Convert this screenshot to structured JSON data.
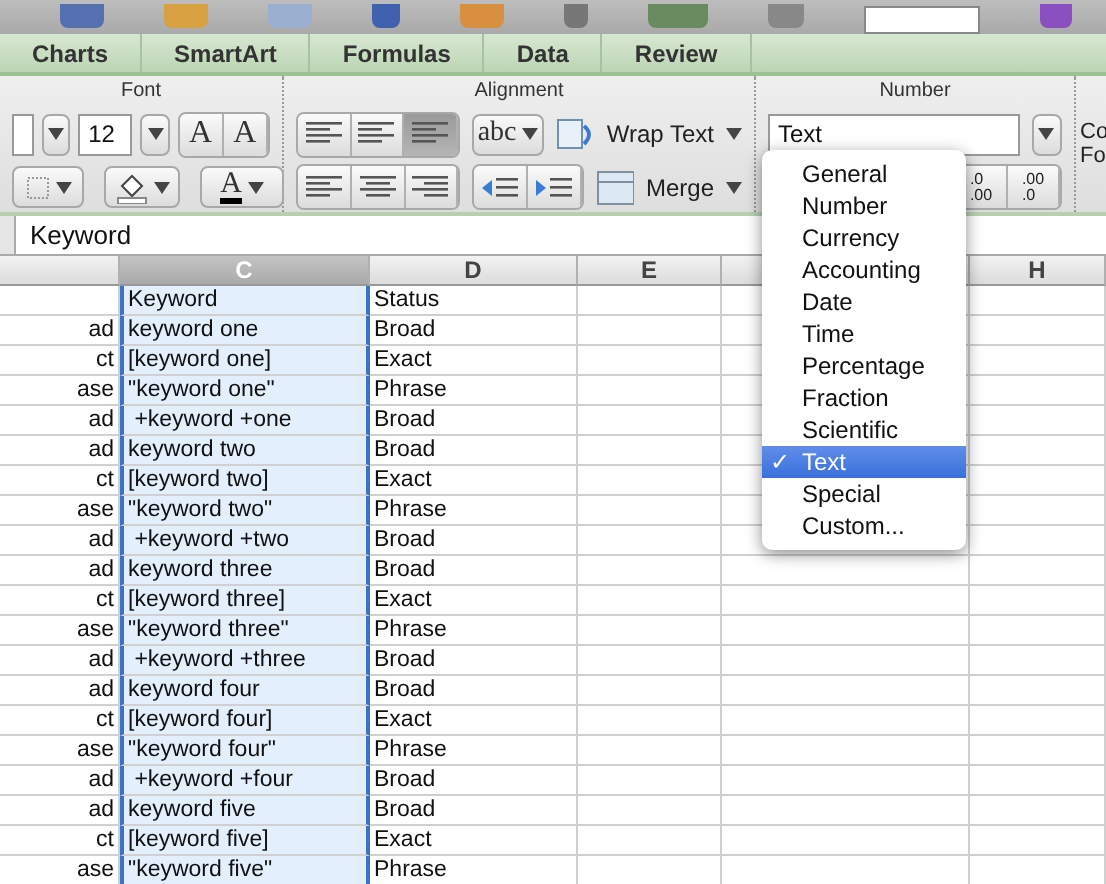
{
  "ribbon_tabs": [
    {
      "label": "Charts"
    },
    {
      "label": "SmartArt"
    },
    {
      "label": "Formulas"
    },
    {
      "label": "Data"
    },
    {
      "label": "Review"
    }
  ],
  "font_group": {
    "label": "Font",
    "size": "12",
    "grow_glyph": "A",
    "shrink_glyph": "A",
    "color_glyph": "A"
  },
  "alignment_group": {
    "label": "Alignment",
    "orientation_glyph": "abc",
    "wrap_text": "Wrap Text",
    "merge": "Merge"
  },
  "number_group": {
    "label": "Number",
    "format": "Text",
    "decimal_increase": [
      ".0",
      ".00"
    ],
    "decimal_decrease": [
      ".00",
      ".0"
    ]
  },
  "next_group_cut": [
    "Co",
    "Fo"
  ],
  "formula_bar": {
    "value": "Keyword"
  },
  "columns": [
    {
      "label": "C",
      "selected": true
    },
    {
      "label": "D",
      "selected": false
    },
    {
      "label": "E",
      "selected": false
    },
    {
      "label": "H",
      "selected": false
    }
  ],
  "rows": [
    {
      "keyword": "Keyword",
      "status": "Status"
    },
    {
      "column_b": "ad",
      "keyword": "keyword one",
      "status": "Broad"
    },
    {
      "column_b": "ct",
      "keyword": "[keyword one]",
      "status": "Exact"
    },
    {
      "column_b": "ase",
      "keyword": "\"keyword one\"",
      "status": "Phrase"
    },
    {
      "column_b": "ad",
      "keyword": " +keyword +one",
      "status": "Broad"
    },
    {
      "column_b": "ad",
      "keyword": "keyword two",
      "status": "Broad"
    },
    {
      "column_b": "ct",
      "keyword": "[keyword two]",
      "status": "Exact"
    },
    {
      "column_b": "ase",
      "keyword": "\"keyword two\"",
      "status": "Phrase"
    },
    {
      "column_b": "ad",
      "keyword": " +keyword +two",
      "status": "Broad"
    },
    {
      "column_b": "ad",
      "keyword": "keyword three",
      "status": "Broad"
    },
    {
      "column_b": "ct",
      "keyword": "[keyword three]",
      "status": "Exact"
    },
    {
      "column_b": "ase",
      "keyword": "\"keyword three\"",
      "status": "Phrase"
    },
    {
      "column_b": "ad",
      "keyword": " +keyword +three",
      "status": "Broad"
    },
    {
      "column_b": "ad",
      "keyword": "keyword four",
      "status": "Broad"
    },
    {
      "column_b": "ct",
      "keyword": "[keyword four]",
      "status": "Exact"
    },
    {
      "column_b": "ase",
      "keyword": "\"keyword four\"",
      "status": "Phrase"
    },
    {
      "column_b": "ad",
      "keyword": " +keyword +four",
      "status": "Broad"
    },
    {
      "column_b": "ad",
      "keyword": "keyword five",
      "status": "Broad"
    },
    {
      "column_b": "ct",
      "keyword": "[keyword five]",
      "status": "Exact"
    },
    {
      "column_b": "ase",
      "keyword": "\"keyword five\"",
      "status": "Phrase"
    }
  ],
  "format_menu": {
    "check_glyph": "✓",
    "items": [
      {
        "label": "General",
        "selected": false
      },
      {
        "label": "Number",
        "selected": false
      },
      {
        "label": "Currency",
        "selected": false
      },
      {
        "label": "Accounting",
        "selected": false
      },
      {
        "label": "Date",
        "selected": false
      },
      {
        "label": "Time",
        "selected": false
      },
      {
        "label": "Percentage",
        "selected": false
      },
      {
        "label": "Fraction",
        "selected": false
      },
      {
        "label": "Scientific",
        "selected": false
      },
      {
        "label": "Text",
        "selected": true
      },
      {
        "label": "Special",
        "selected": false
      },
      {
        "label": "Custom...",
        "selected": false
      }
    ]
  }
}
